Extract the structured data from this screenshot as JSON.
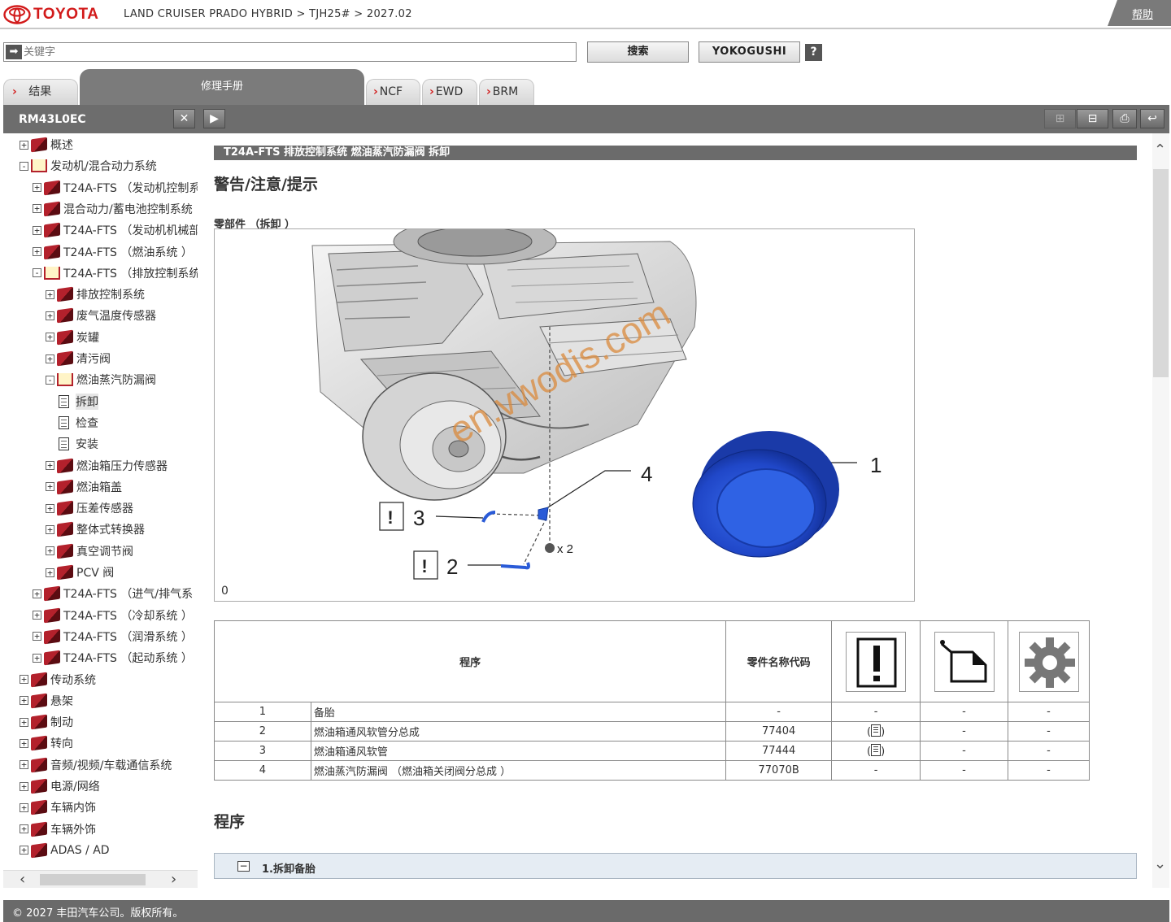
{
  "header": {
    "brand": "TOYOTA",
    "breadcrumb": "LAND CRUISER PRADO HYBRID > TJH25# > 2027.02",
    "help_label": "帮助"
  },
  "search": {
    "placeholder": "关键字",
    "search_label": "搜索",
    "yokogushi_label": "YOKOGUSHI",
    "help_icon": "?"
  },
  "tabs": {
    "results": "结果",
    "manual": "修理手册",
    "ncf": "NCF",
    "ewd": "EWD",
    "brm": "BRM"
  },
  "toolbar": {
    "doc_id": "RM43L0EC"
  },
  "tree": [
    {
      "label": "概述",
      "level": 0,
      "toggle": "+",
      "icon": "book-closed"
    },
    {
      "label": "发动机/混合动力系统",
      "level": 0,
      "toggle": "−",
      "icon": "book-open"
    },
    {
      "label": "T24A-FTS （发动机控制系",
      "level": 1,
      "toggle": "+",
      "icon": "book-closed"
    },
    {
      "label": "混合动力/蓄电池控制系统",
      "level": 1,
      "toggle": "+",
      "icon": "book-closed"
    },
    {
      "label": "T24A-FTS （发动机机械部",
      "level": 1,
      "toggle": "+",
      "icon": "book-closed"
    },
    {
      "label": "T24A-FTS （燃油系统 ）",
      "level": 1,
      "toggle": "+",
      "icon": "book-closed"
    },
    {
      "label": "T24A-FTS （排放控制系统",
      "level": 1,
      "toggle": "−",
      "icon": "book-open"
    },
    {
      "label": "排放控制系统",
      "level": 2,
      "toggle": "+",
      "icon": "book-closed"
    },
    {
      "label": "废气温度传感器",
      "level": 2,
      "toggle": "+",
      "icon": "book-closed"
    },
    {
      "label": "炭罐",
      "level": 2,
      "toggle": "+",
      "icon": "book-closed"
    },
    {
      "label": "清污阀",
      "level": 2,
      "toggle": "+",
      "icon": "book-closed"
    },
    {
      "label": "燃油蒸汽防漏阀",
      "level": 2,
      "toggle": "−",
      "icon": "book-open"
    },
    {
      "label": "拆卸",
      "level": 3,
      "toggle": "",
      "icon": "page",
      "selected": true
    },
    {
      "label": "检查",
      "level": 3,
      "toggle": "",
      "icon": "page"
    },
    {
      "label": "安装",
      "level": 3,
      "toggle": "",
      "icon": "page"
    },
    {
      "label": "燃油箱压力传感器",
      "level": 2,
      "toggle": "+",
      "icon": "book-closed"
    },
    {
      "label": "燃油箱盖",
      "level": 2,
      "toggle": "+",
      "icon": "book-closed"
    },
    {
      "label": "压差传感器",
      "level": 2,
      "toggle": "+",
      "icon": "book-closed"
    },
    {
      "label": "整体式转换器",
      "level": 2,
      "toggle": "+",
      "icon": "book-closed"
    },
    {
      "label": "真空调节阀",
      "level": 2,
      "toggle": "+",
      "icon": "book-closed"
    },
    {
      "label": "PCV 阀",
      "level": 2,
      "toggle": "+",
      "icon": "book-closed"
    },
    {
      "label": "T24A-FTS （进气/排气系",
      "level": 1,
      "toggle": "+",
      "icon": "book-closed"
    },
    {
      "label": "T24A-FTS （冷却系统 ）",
      "level": 1,
      "toggle": "+",
      "icon": "book-closed"
    },
    {
      "label": "T24A-FTS （润滑系统 ）",
      "level": 1,
      "toggle": "+",
      "icon": "book-closed"
    },
    {
      "label": "T24A-FTS （起动系统 ）",
      "level": 1,
      "toggle": "+",
      "icon": "book-closed"
    },
    {
      "label": "传动系统",
      "level": 0,
      "toggle": "+",
      "icon": "book-closed"
    },
    {
      "label": "悬架",
      "level": 0,
      "toggle": "+",
      "icon": "book-closed"
    },
    {
      "label": "制动",
      "level": 0,
      "toggle": "+",
      "icon": "book-closed"
    },
    {
      "label": "转向",
      "level": 0,
      "toggle": "+",
      "icon": "book-closed"
    },
    {
      "label": "音频/视频/车载通信系统",
      "level": 0,
      "toggle": "+",
      "icon": "book-closed"
    },
    {
      "label": "电源/网络",
      "level": 0,
      "toggle": "+",
      "icon": "book-closed"
    },
    {
      "label": "车辆内饰",
      "level": 0,
      "toggle": "+",
      "icon": "book-closed"
    },
    {
      "label": "车辆外饰",
      "level": 0,
      "toggle": "+",
      "icon": "book-closed"
    },
    {
      "label": "ADAS / AD",
      "level": 0,
      "toggle": "+",
      "icon": "book-closed"
    }
  ],
  "main": {
    "section_title": "T24A-FTS 排放控制系统  燃油蒸汽防漏阀  拆卸",
    "warning_heading": "警告/注意/提示",
    "parts_heading": "零部件 （拆卸 ）",
    "figure": {
      "callout_1": "1",
      "callout_2": "2",
      "callout_3": "3",
      "callout_4": "4",
      "warn_mark": "!",
      "clip_qty": "x 2",
      "figure_label": "0",
      "watermark": "en.vwodis.com"
    },
    "table": {
      "col_procedure": "程序",
      "col_part_code": "零件名称代码",
      "icons": [
        "warning-icon",
        "lubricant-icon",
        "gear-icon"
      ],
      "rows": [
        {
          "no": "1",
          "name": "备胎",
          "code": "-",
          "c1": "-",
          "c2": "-",
          "c3": "-"
        },
        {
          "no": "2",
          "name": "燃油箱通风软管分总成",
          "code": "77404",
          "c1": "doc",
          "c2": "-",
          "c3": "-"
        },
        {
          "no": "3",
          "name": "燃油箱通风软管",
          "code": "77444",
          "c1": "doc",
          "c2": "-",
          "c3": "-"
        },
        {
          "no": "4",
          "name": "燃油蒸汽防漏阀 （燃油箱关闭阀分总成 ）",
          "code": "77070B",
          "c1": "-",
          "c2": "-",
          "c3": "-"
        }
      ]
    },
    "procedure_heading": "程序",
    "step_1": "1.拆卸备胎"
  },
  "footer": {
    "copyright": "© 2027 丰田汽车公司。版权所有。"
  },
  "colors": {
    "brand_red": "#d21a1a",
    "toolbar_grey": "#6d6d6d",
    "tire_blue": "#2a5bd7",
    "watermark": "#d98a3c"
  }
}
